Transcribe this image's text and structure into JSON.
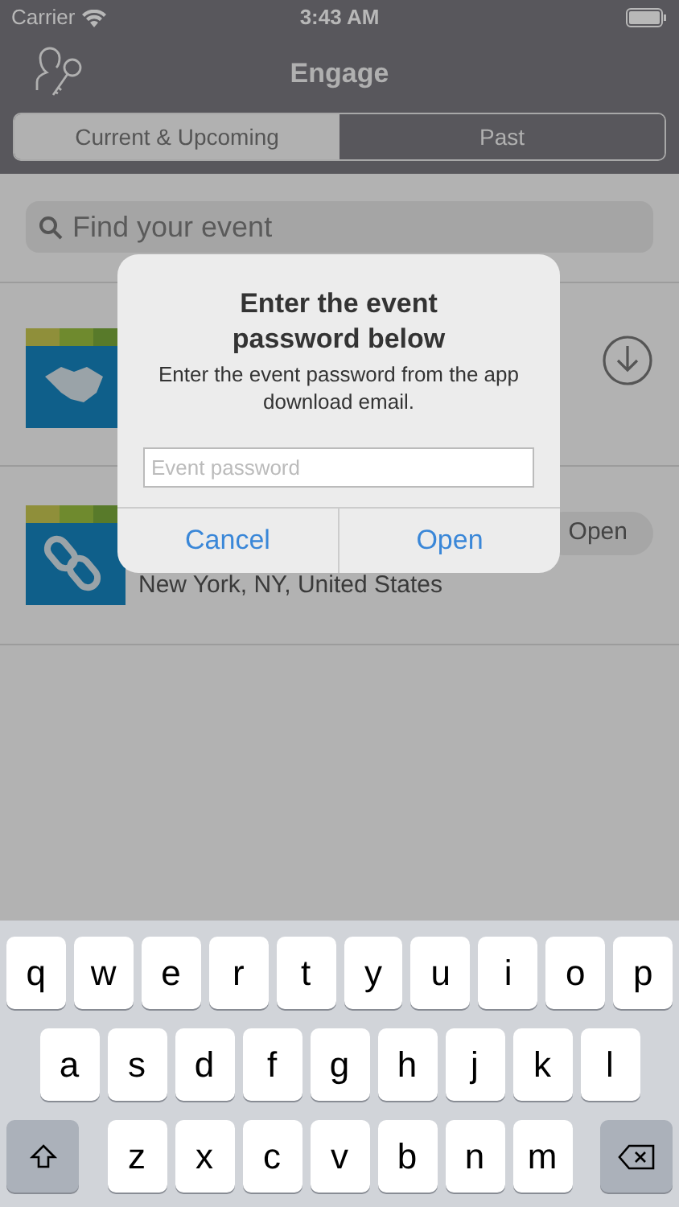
{
  "status_bar": {
    "carrier": "Carrier",
    "time": "3:43 AM"
  },
  "header": {
    "title": "Engage"
  },
  "tabs": [
    {
      "label": "Current & Upcoming",
      "selected": true
    },
    {
      "label": "Past",
      "selected": false
    }
  ],
  "search": {
    "placeholder": "Find your event"
  },
  "events": [
    {
      "kind": "handshake",
      "action": {
        "kind": "download"
      }
    },
    {
      "kind": "link",
      "location": "New York, NY, United States",
      "action": {
        "kind": "button",
        "label": "Open"
      }
    }
  ],
  "dialog": {
    "title": "Enter the event password below",
    "message": "Enter the event password from the app download email.",
    "field": {
      "placeholder": "Event password"
    },
    "buttons": [
      "Cancel",
      "Open"
    ]
  },
  "keyboard": {
    "rows": [
      [
        "q",
        "w",
        "e",
        "r",
        "t",
        "y",
        "u",
        "i",
        "o",
        "p"
      ],
      [
        "a",
        "s",
        "d",
        "f",
        "g",
        "h",
        "j",
        "k",
        "l"
      ],
      [
        "z",
        "x",
        "c",
        "v",
        "b",
        "n",
        "m"
      ]
    ]
  }
}
